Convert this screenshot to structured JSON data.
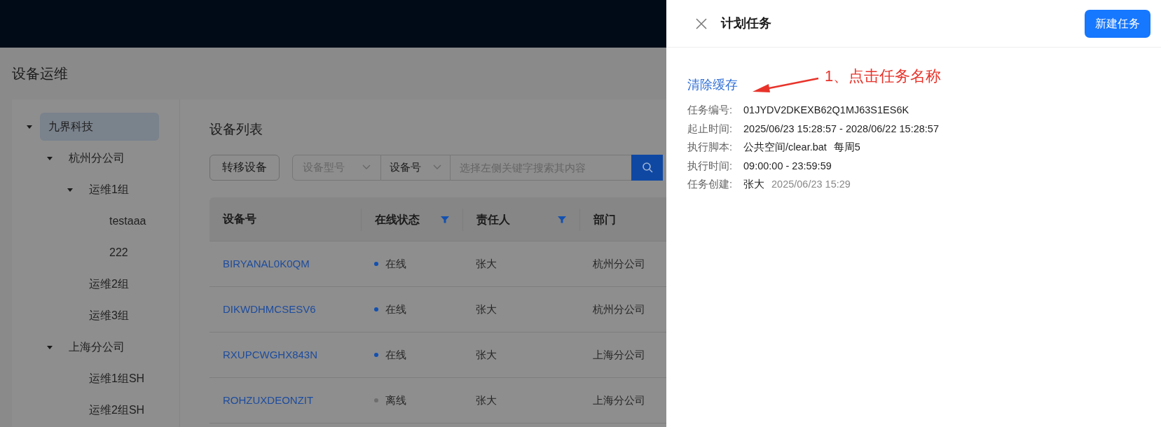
{
  "page_title": "设备运维",
  "tree": [
    {
      "label": "九界科技",
      "expanded": true,
      "selected": true,
      "children": [
        {
          "label": "杭州分公司",
          "expanded": true,
          "selected": false,
          "children": [
            {
              "label": "运维1组",
              "expanded": true,
              "selected": false,
              "children": [
                {
                  "label": "testaaa",
                  "selected": false
                },
                {
                  "label": "222",
                  "selected": false
                }
              ]
            },
            {
              "label": "运维2组",
              "selected": false
            },
            {
              "label": "运维3组",
              "selected": false
            }
          ]
        },
        {
          "label": "上海分公司",
          "expanded": true,
          "selected": false,
          "children": [
            {
              "label": "运维1组SH",
              "selected": false
            },
            {
              "label": "运维2组SH",
              "selected": false
            }
          ]
        }
      ]
    }
  ],
  "device_list": {
    "title": "设备列表",
    "transfer_button": "转移设备",
    "model_select": {
      "placeholder": "设备型号"
    },
    "key_select": {
      "value": "设备号"
    },
    "search": {
      "placeholder": "选择左侧关键字搜索其内容"
    },
    "table": {
      "columns": [
        {
          "label": "设备号",
          "filter": false
        },
        {
          "label": "在线状态",
          "filter": true
        },
        {
          "label": "责任人",
          "filter": true
        },
        {
          "label": "部门",
          "filter": false
        }
      ],
      "rows": [
        {
          "device": "BIRYANAL0K0QM",
          "online": true,
          "status": "在线",
          "owner": "张大",
          "department": "杭州分公司"
        },
        {
          "device": "DIKWDHMCSESV6",
          "online": true,
          "status": "在线",
          "owner": "张大",
          "department": "杭州分公司"
        },
        {
          "device": "RXUPCWGHX843N",
          "online": true,
          "status": "在线",
          "owner": "张大",
          "department": "上海分公司"
        },
        {
          "device": "ROHZUXDEONZIT",
          "online": false,
          "status": "离线",
          "owner": "张大",
          "department": "上海分公司"
        }
      ]
    }
  },
  "drawer": {
    "title": "计划任务",
    "new_button": "新建任务",
    "task_name": "清除缓存",
    "annotation": "1、点击任务名称",
    "fields": [
      {
        "label": "任务编号:",
        "value": "01JYDV2DKEXB62Q1MJ63S1ES6K"
      },
      {
        "label": "起止时间:",
        "value": "2025/06/23 15:28:57 - 2028/06/22 15:28:57"
      },
      {
        "label": "执行脚本:",
        "value": "公共空间/clear.bat",
        "extra": "每周5",
        "muted": false
      },
      {
        "label": "执行时间:",
        "value": "09:00:00 - 23:59:59"
      },
      {
        "label": "任务创建:",
        "value": "张大",
        "extra": "2025/06/23 15:29",
        "muted": true
      }
    ]
  }
}
